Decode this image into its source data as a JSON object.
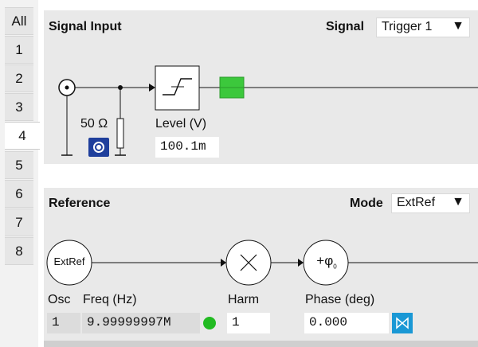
{
  "tabs": [
    "All",
    "1",
    "2",
    "3",
    "4",
    "5",
    "6",
    "7",
    "8"
  ],
  "active_tab": "4",
  "signal_input": {
    "title": "Signal Input",
    "signal_label": "Signal",
    "signal_value": "Trigger 1",
    "impedance_label": "50 Ω",
    "level_label": "Level (V)",
    "level_value": "100.1m",
    "impedance_toggle_on": true,
    "indicator_color": "#3cc83c"
  },
  "reference": {
    "title": "Reference",
    "mode_label": "Mode",
    "mode_value": "ExtRef",
    "extref_node": "ExtRef",
    "osc_label": "Osc",
    "osc_value": "1",
    "freq_label": "Freq (Hz)",
    "freq_value": "9.99999997M",
    "lock_status_color": "#22bb22",
    "harm_label": "Harm",
    "harm_value": "1",
    "phase_label": "Phase (deg)",
    "phase_value": "0.000",
    "phase_node": "+φ",
    "phase_node_sub": "0",
    "auto_phase_icon": "bowtie-icon",
    "accent_color": "#1a98d5"
  }
}
